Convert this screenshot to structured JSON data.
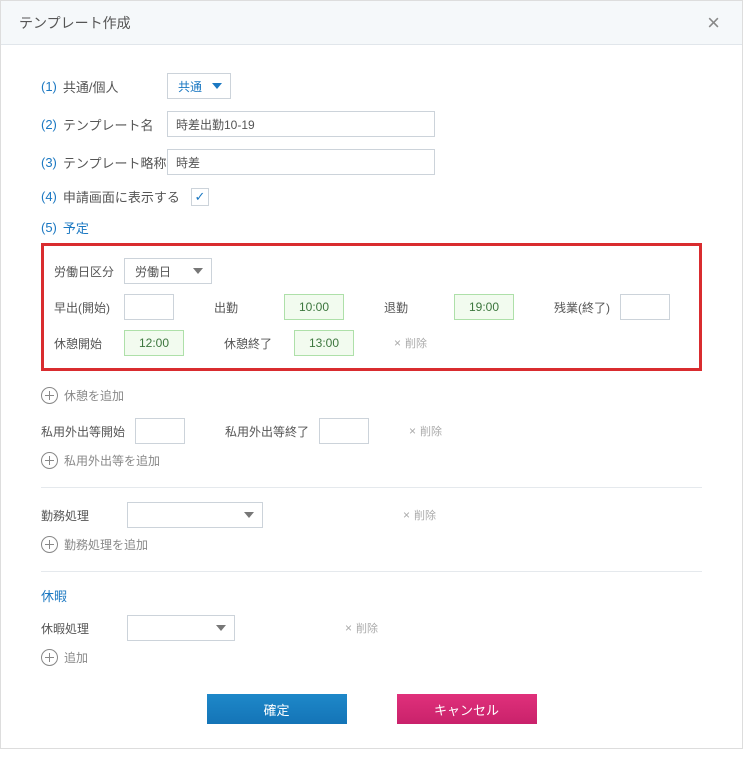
{
  "header": {
    "title": "テンプレート作成"
  },
  "num": {
    "n1": "(1)",
    "n2": "(2)",
    "n3": "(3)",
    "n4": "(4)",
    "n5": "(5)"
  },
  "labels": {
    "scope": "共通/個人",
    "name": "テンプレート名",
    "abbr": "テンプレート略称",
    "showOnApply": "申請画面に表示する",
    "schedule": "予定",
    "workdayType": "労働日区分",
    "earlyStart": "早出(開始)",
    "clockIn": "出勤",
    "clockOut": "退勤",
    "overtimeEnd": "残業(終了)",
    "breakStart": "休憩開始",
    "breakEnd": "休憩終了",
    "delete": "削除",
    "addBreak": "休憩を追加",
    "outStart": "私用外出等開始",
    "outEnd": "私用外出等終了",
    "addOuting": "私用外出等を追加",
    "workProc": "勤務処理",
    "addWorkProc": "勤務処理を追加",
    "vacation": "休暇",
    "vacationProc": "休暇処理",
    "add": "追加"
  },
  "values": {
    "scope": "共通",
    "name": "時差出勤10-19",
    "abbr": "時差",
    "checked": "✓",
    "workdayType": "労働日",
    "clockIn": "10:00",
    "clockOut": "19:00",
    "breakStart": "12:00",
    "breakEnd": "13:00"
  },
  "buttons": {
    "confirm": "確定",
    "cancel": "キャンセル"
  }
}
